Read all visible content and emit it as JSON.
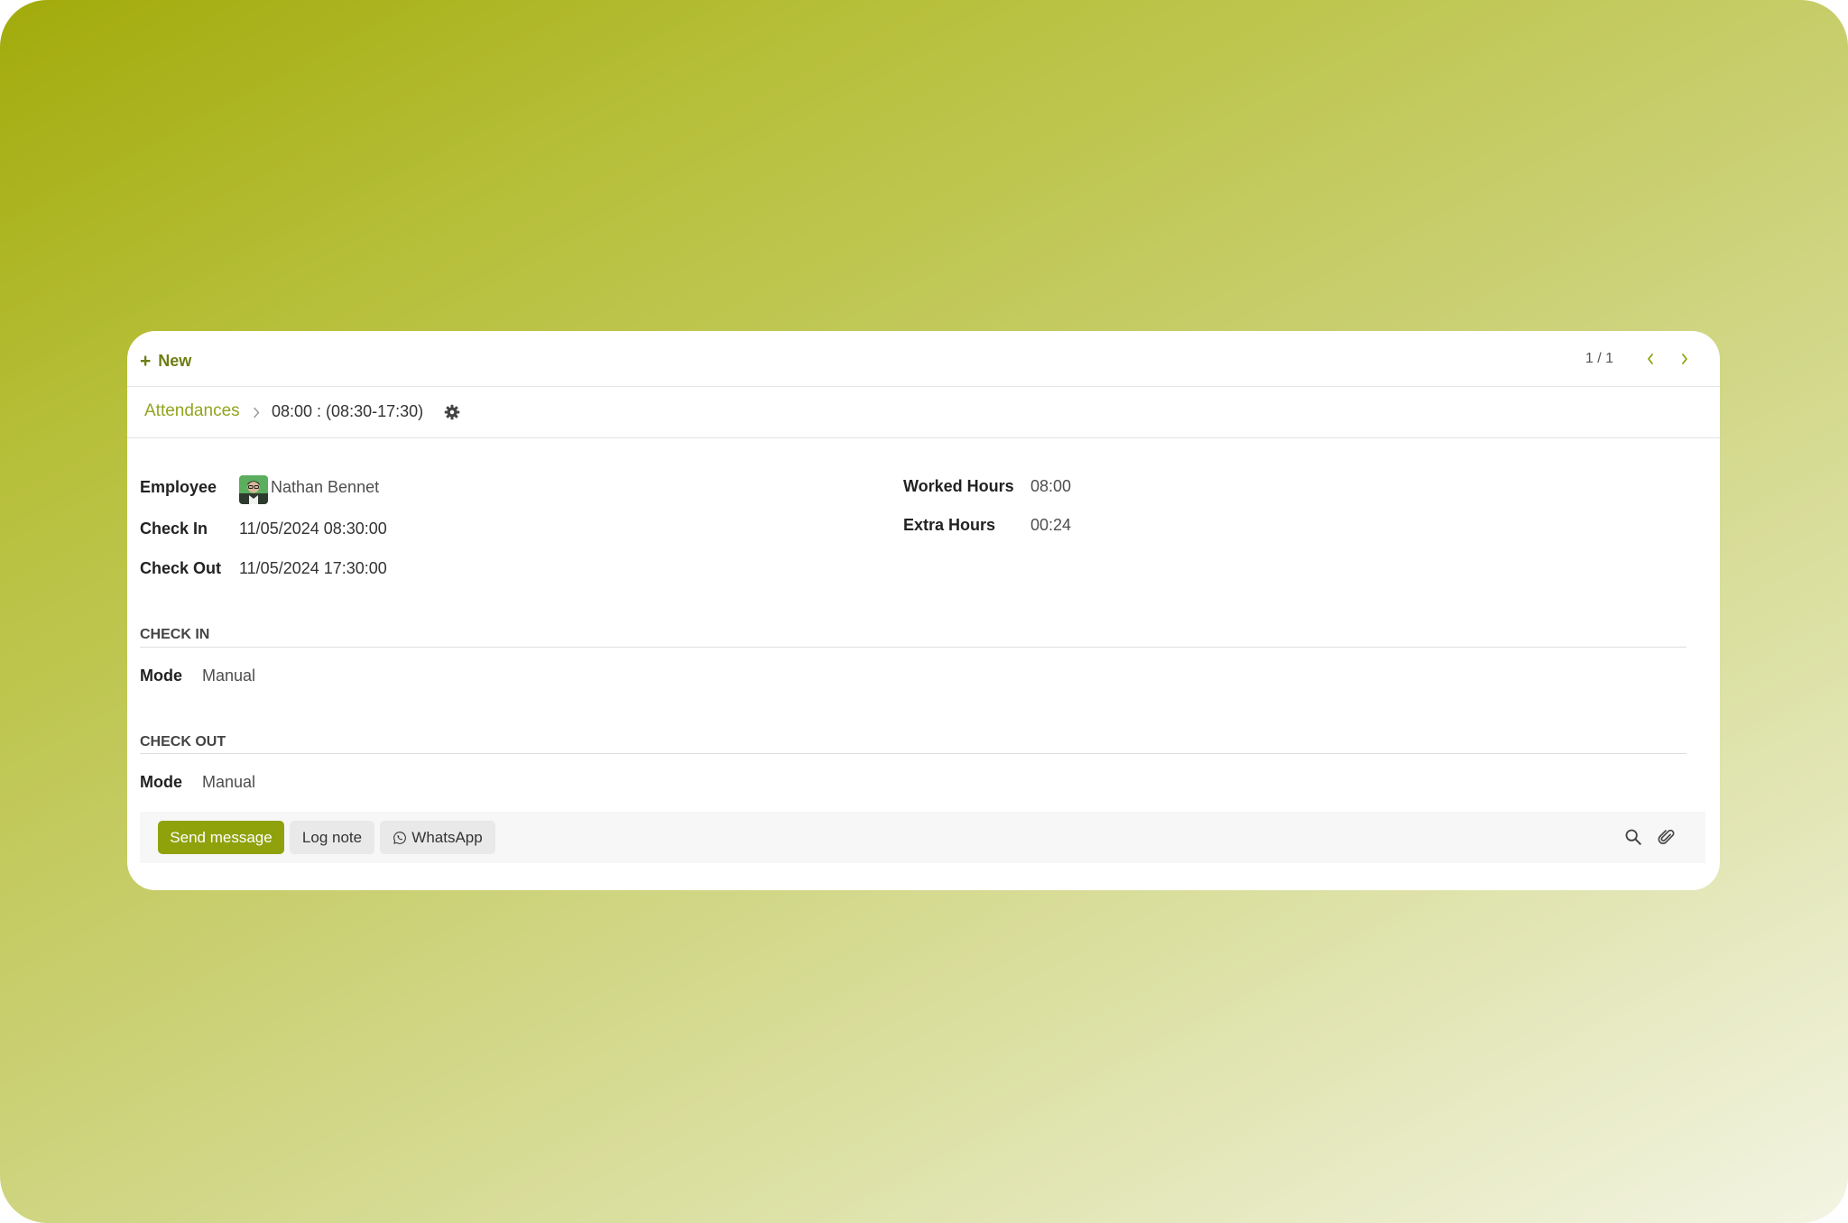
{
  "control_panel": {
    "new_label": "New",
    "pager_value": "1 / 1"
  },
  "breadcrumb": {
    "parent": "Attendances",
    "current": "08:00 : (08:30-17:30)"
  },
  "form": {
    "employee_label": "Employee",
    "employee_value": "Nathan Bennet",
    "check_in_label": "Check In",
    "check_in_value": "11/05/2024 08:30:00",
    "check_out_label": "Check Out",
    "check_out_value": "11/05/2024 17:30:00",
    "worked_hours_label": "Worked Hours",
    "worked_hours_value": "08:00",
    "extra_hours_label": "Extra Hours",
    "extra_hours_value": "00:24"
  },
  "sections": {
    "check_in": {
      "title": "CHECK IN",
      "mode_label": "Mode",
      "mode_value": "Manual"
    },
    "check_out": {
      "title": "CHECK OUT",
      "mode_label": "Mode",
      "mode_value": "Manual"
    }
  },
  "chatter": {
    "send_message": "Send message",
    "log_note": "Log note",
    "whatsapp": "WhatsApp",
    "icons": [
      "search-icon",
      "paperclip-icon",
      "whatsapp-icon"
    ]
  },
  "colors": {
    "accent": "#8fa20b",
    "link": "#94a420",
    "new_button": "#6f7d12"
  }
}
